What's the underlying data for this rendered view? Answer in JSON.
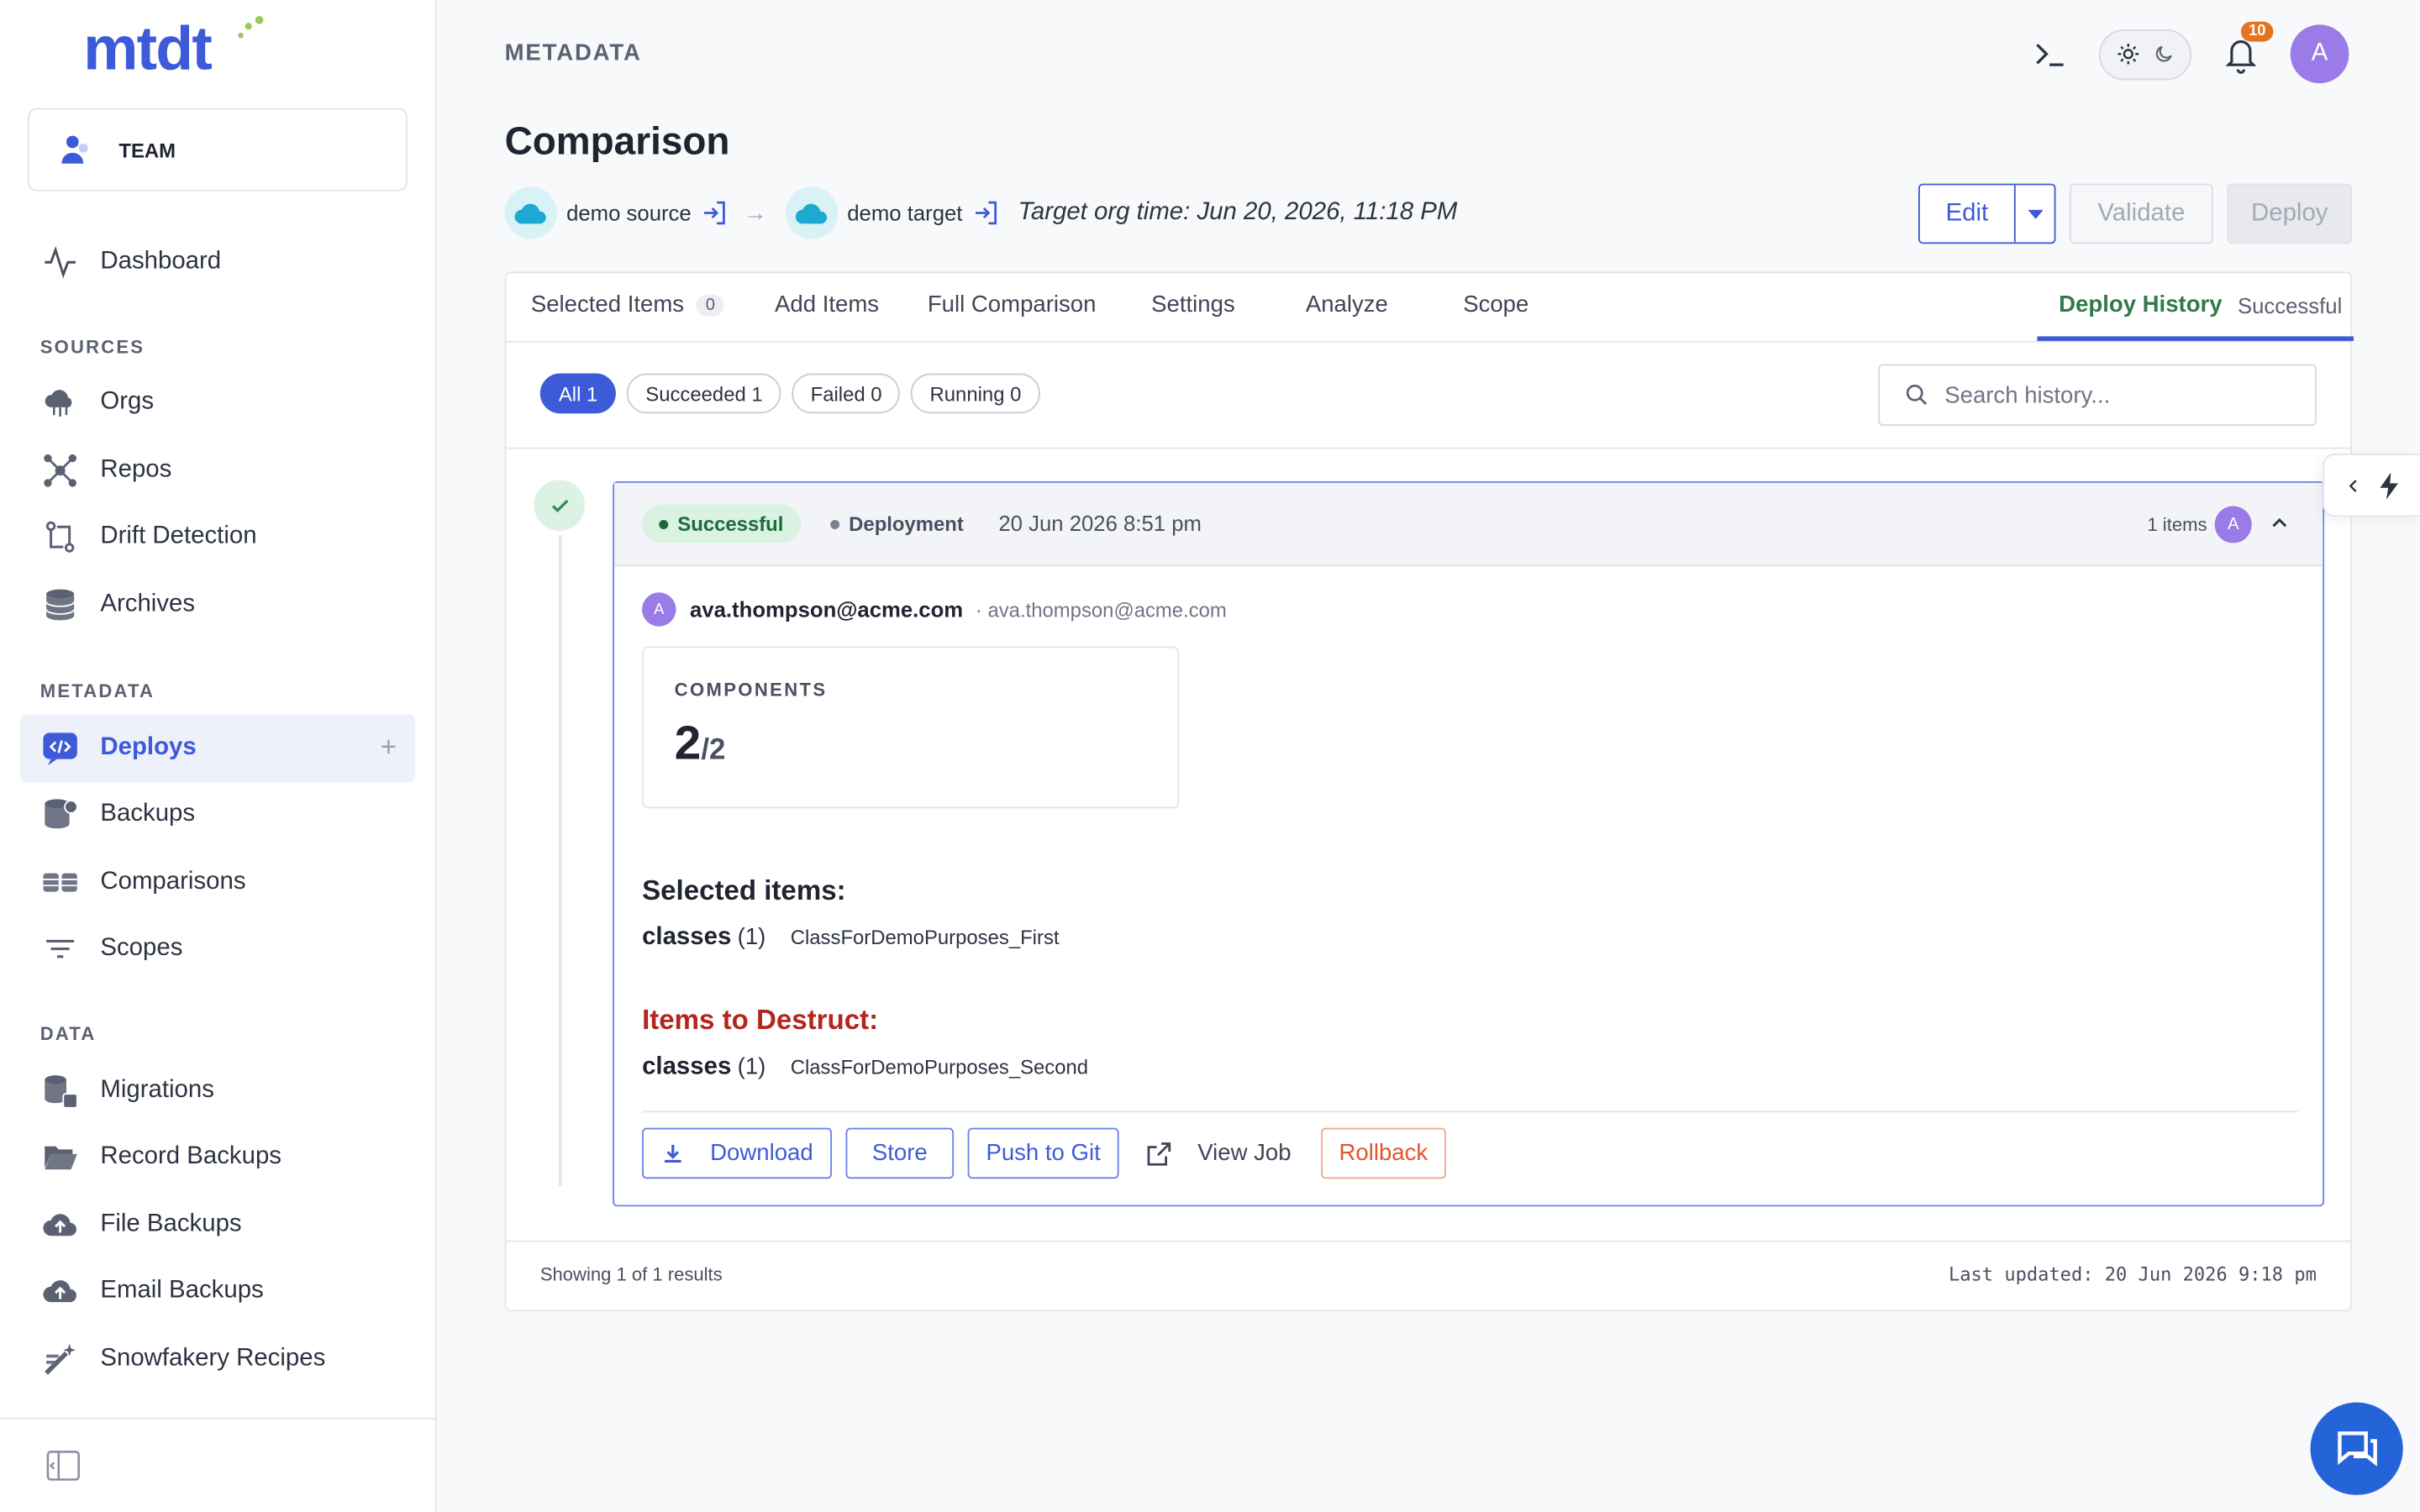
{
  "app": {
    "logo": "mtdt"
  },
  "team": {
    "label": "TEAM"
  },
  "sidebar": {
    "top_item": {
      "label": "Dashboard",
      "icon": "activity-icon"
    },
    "sections": [
      {
        "title": "SOURCES",
        "items": [
          {
            "label": "Orgs",
            "icon": "cloud-network-icon"
          },
          {
            "label": "Repos",
            "icon": "nodes-icon"
          },
          {
            "label": "Drift Detection",
            "icon": "git-compare-icon"
          },
          {
            "label": "Archives",
            "icon": "database-icon"
          }
        ]
      },
      {
        "title": "METADATA",
        "items": [
          {
            "label": "Deploys",
            "icon": "code-chat-icon",
            "active": true
          },
          {
            "label": "Backups",
            "icon": "database-backup-icon"
          },
          {
            "label": "Comparisons",
            "icon": "compare-stack-icon"
          },
          {
            "label": "Scopes",
            "icon": "filter-lines-icon"
          }
        ]
      },
      {
        "title": "DATA",
        "items": [
          {
            "label": "Migrations",
            "icon": "database-migrate-icon"
          },
          {
            "label": "Record Backups",
            "icon": "folder-open-icon"
          },
          {
            "label": "File Backups",
            "icon": "cloud-upload-icon"
          },
          {
            "label": "Email Backups",
            "icon": "cloud-mail-icon"
          },
          {
            "label": "Snowfakery Recipes",
            "icon": "wand-icon"
          }
        ]
      }
    ]
  },
  "header": {
    "breadcrumb": "METADATA",
    "notifications_count": "10",
    "user_initial": "A"
  },
  "page": {
    "title": "Comparison",
    "source_org": "demo source",
    "target_org": "demo target",
    "org_time": "Target org time: Jun 20, 2026, 11:18 PM",
    "buttons": {
      "edit": "Edit",
      "validate": "Validate",
      "deploy": "Deploy"
    }
  },
  "tabs": {
    "selected_items": "Selected Items",
    "selected_items_count": "0",
    "add_items": "Add Items",
    "full_comparison": "Full Comparison",
    "settings": "Settings",
    "analyze": "Analyze",
    "scope": "Scope",
    "deploy_history": "Deploy History",
    "deploy_history_sub": "Successful"
  },
  "filters": {
    "all": "All 1",
    "succeeded": "Succeeded 1",
    "failed": "Failed 0",
    "running": "Running 0"
  },
  "search": {
    "placeholder": "Search history..."
  },
  "deploy": {
    "status": "Successful",
    "type": "Deployment",
    "date": "20 Jun 2026 8:51 pm",
    "items": "1 items",
    "avatar": "A",
    "user_name": "ava.thompson@acme.com",
    "user_sub": "· ava.thompson@acme.com",
    "components_label": "COMPONENTS",
    "components_value": "2",
    "components_total": "/2",
    "selected_title": "Selected items:",
    "selected_key": "classes",
    "selected_count": "(1)",
    "selected_value": "ClassForDemoPurposes_First",
    "destruct_title": "Items to Destruct:",
    "destruct_key": "classes",
    "destruct_count": "(1)",
    "destruct_value": "ClassForDemoPurposes_Second",
    "actions": {
      "download": "Download",
      "store": "Store",
      "push": "Push to Git",
      "view_job": "View Job",
      "rollback": "Rollback"
    }
  },
  "footer": {
    "showing": "Showing 1 of 1 results",
    "updated": "Last updated: 20 Jun 2026 9:18 pm"
  },
  "colors": {
    "accent": "#3d5bd9",
    "success": "#1d6b3a",
    "danger": "#b3261e",
    "rollback": "#e1562a"
  }
}
